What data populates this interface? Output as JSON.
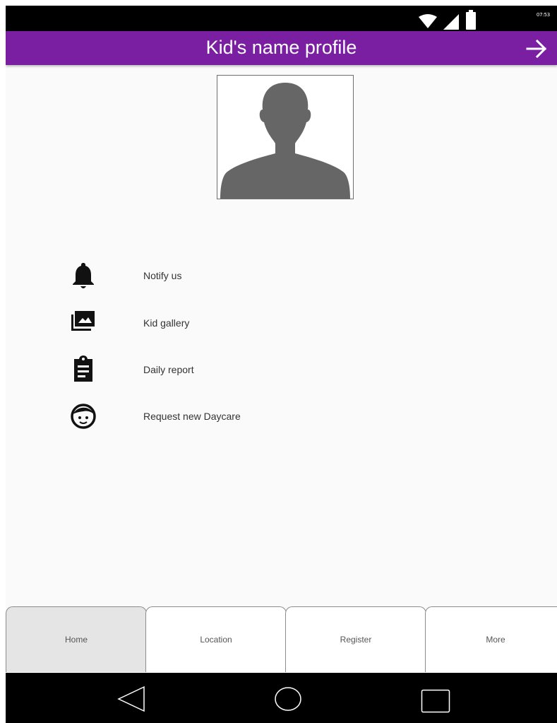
{
  "status_bar": {
    "time": "07:53",
    "icons": [
      "wifi-icon",
      "signal-icon",
      "battery-icon"
    ]
  },
  "app_bar": {
    "title": "Kid's name profile",
    "action_icon": "arrow-right-icon",
    "background_color": "#7b1fa2"
  },
  "profile": {
    "avatar_icon": "person-silhouette-icon"
  },
  "menu": {
    "items": [
      {
        "label": "Notify us",
        "icon": "bell-icon"
      },
      {
        "label": "Kid gallery",
        "icon": "photo-library-icon"
      },
      {
        "label": "Daily report",
        "icon": "clipboard-icon"
      },
      {
        "label": "Request new Daycare",
        "icon": "child-face-icon"
      }
    ]
  },
  "bottom_nav": {
    "tabs": [
      {
        "label": "Home",
        "active": true
      },
      {
        "label": "Location",
        "active": false
      },
      {
        "label": "Register",
        "active": false
      },
      {
        "label": "More",
        "active": false
      }
    ]
  },
  "system_nav": {
    "icons": [
      "back-icon",
      "home-circle-icon",
      "recents-icon"
    ]
  }
}
